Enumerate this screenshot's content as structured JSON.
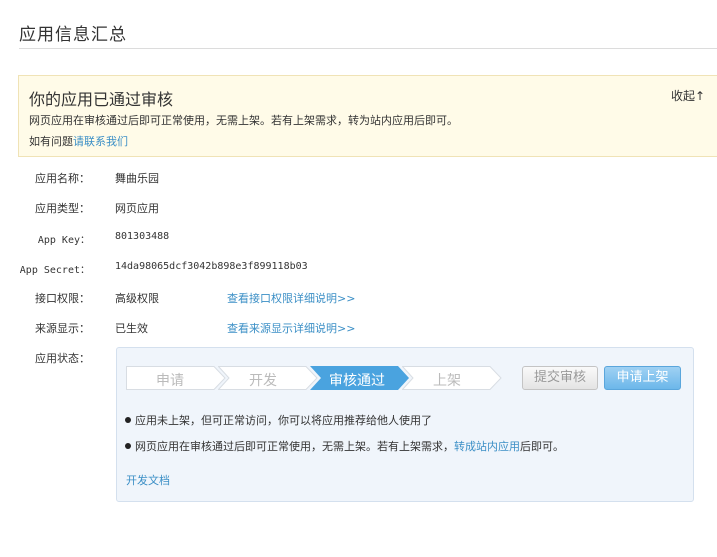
{
  "page": {
    "title": "应用信息汇总"
  },
  "notice": {
    "title": "你的应用已通过审核",
    "collapse": "收起↑",
    "line1": "网页应用在审核通过后即可正常使用，无需上架。若有上架需求，转为站内应用后即可。",
    "line2_prefix": "如有问题",
    "line2_link": "请联系我们"
  },
  "info": {
    "app_name": {
      "label": "应用名称：",
      "value": "舞曲乐园"
    },
    "app_type": {
      "label": "应用类型：",
      "value": "网页应用"
    },
    "app_key": {
      "label": "App Key：",
      "value": "801303488"
    },
    "app_secret": {
      "label": "App Secret：",
      "value": "14da98065dcf3042b898e3f899118b03"
    },
    "api_permission": {
      "label": "接口权限：",
      "value": "高级权限",
      "link": "查看接口权限详细说明>>"
    },
    "source_display": {
      "label": "来源显示：",
      "value": "已生效",
      "link": "查看来源显示详细说明>>"
    },
    "app_status": {
      "label": "应用状态："
    }
  },
  "status": {
    "steps": [
      "申请",
      "开发",
      "审核通过",
      "上架"
    ],
    "active_step": 2,
    "submit_button": "提交审核",
    "publish_button": "申请上架",
    "bullet1": "应用未上架，但可正常访问，你可以将应用推荐给他人使用了",
    "bullet2_prefix": "网页应用在审核通过后即可正常使用，无需上架。若有上架需求，",
    "bullet2_link": "转成站内应用",
    "bullet2_suffix": "后即可。",
    "dev_doc": "开发文档"
  },
  "colors": {
    "link": "#3b8fc6",
    "active_step": "#4aa3df",
    "notice_bg": "#fffbe8",
    "status_bg": "#f0f5fb"
  }
}
